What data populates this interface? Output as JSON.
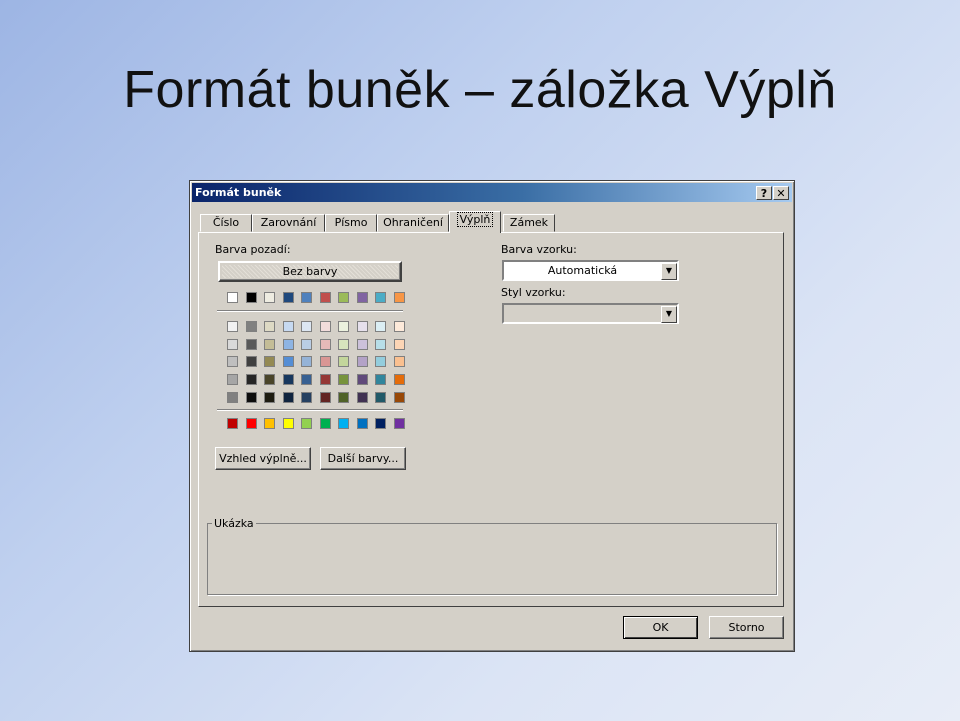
{
  "slide": {
    "title": "Formát buněk – záložka Výplň"
  },
  "dialog": {
    "title": "Formát buněk",
    "help_label": "?",
    "close_label": "✕",
    "tabs": [
      {
        "label": "Číslo"
      },
      {
        "label": "Zarovnání"
      },
      {
        "label": "Písmo"
      },
      {
        "label": "Ohraničení"
      },
      {
        "label": "Výplň"
      },
      {
        "label": "Zámek"
      }
    ],
    "active_tab": "Výplň",
    "background": {
      "label": "Barva pozadí:",
      "no_color_label": "Bez barvy",
      "theme_row": [
        "#ffffff",
        "#000000",
        "#eeece1",
        "#1f497d",
        "#4f81bd",
        "#c0504d",
        "#9bbb59",
        "#8064a2",
        "#4bacc6",
        "#f79646"
      ],
      "shade_rows": [
        [
          "#f2f2f2",
          "#808080",
          "#ddd9c4",
          "#c6d9f1",
          "#dce6f2",
          "#f2dcdb",
          "#ebf1de",
          "#e6e0ec",
          "#dbeef4",
          "#fdeada"
        ],
        [
          "#d9d9d9",
          "#595959",
          "#c4bd97",
          "#8eb4e3",
          "#b9cde5",
          "#e6b9b8",
          "#d7e4bd",
          "#ccc1da",
          "#b7dee8",
          "#fcd5b5"
        ],
        [
          "#bfbfbf",
          "#404040",
          "#948a54",
          "#558ed5",
          "#95b3d7",
          "#d99694",
          "#c3d69b",
          "#b3a2c7",
          "#93cddd",
          "#fac090"
        ],
        [
          "#a6a6a6",
          "#262626",
          "#4a452a",
          "#17375e",
          "#376092",
          "#953735",
          "#77933c",
          "#604a7b",
          "#31859c",
          "#e46c0a"
        ],
        [
          "#808080",
          "#0d0d0d",
          "#1e1c11",
          "#10243f",
          "#254061",
          "#632523",
          "#4f6228",
          "#403152",
          "#215968",
          "#984807"
        ]
      ],
      "standard_row": [
        "#c00000",
        "#ff0000",
        "#ffc000",
        "#ffff00",
        "#92d050",
        "#00b050",
        "#00b0f0",
        "#0070c0",
        "#002060",
        "#7030a0"
      ],
      "fill_effects_label": "Vzhled výplně...",
      "more_colors_label": "Další barvy..."
    },
    "pattern": {
      "color_label": "Barva vzorku:",
      "color_value": "Automatická",
      "style_label": "Styl vzorku:",
      "style_value": ""
    },
    "sample_label": "Ukázka",
    "ok_label": "OK",
    "cancel_label": "Storno"
  }
}
